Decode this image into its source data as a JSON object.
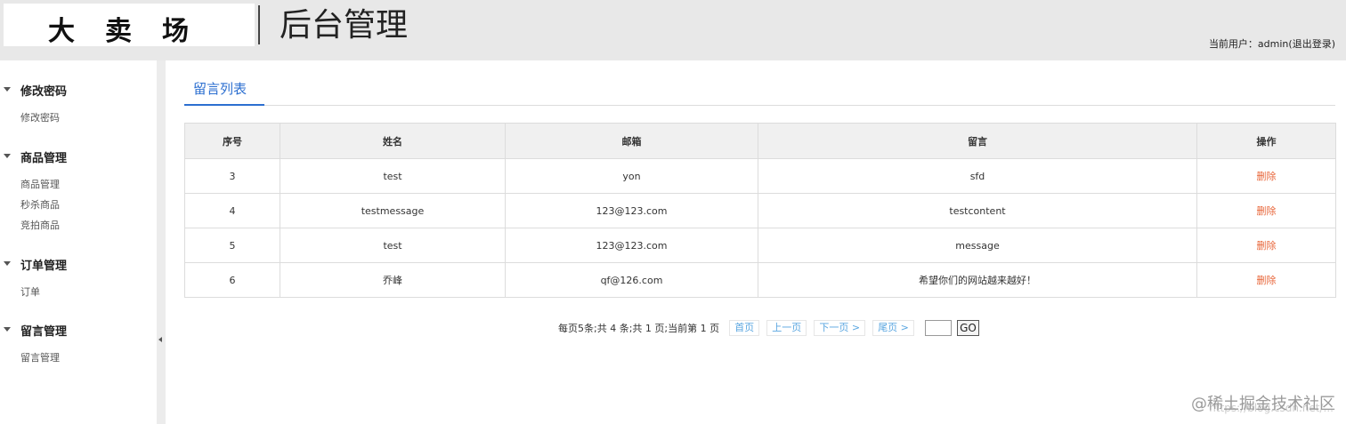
{
  "header": {
    "logo": "大卖场",
    "title": "后台管理",
    "user_prefix": "当前用户：admin",
    "logout": "(退出登录)"
  },
  "sidebar": {
    "groups": [
      {
        "title": "修改密码",
        "items": [
          "修改密码"
        ]
      },
      {
        "title": "商品管理",
        "items": [
          "商品管理",
          "秒杀商品",
          "竞拍商品"
        ]
      },
      {
        "title": "订单管理",
        "items": [
          "订单"
        ]
      },
      {
        "title": "留言管理",
        "items": [
          "留言管理"
        ]
      }
    ]
  },
  "main": {
    "tab": "留言列表",
    "table": {
      "headers": [
        "序号",
        "姓名",
        "邮箱",
        "留言",
        "操作"
      ],
      "rows": [
        {
          "id": "3",
          "name": "test",
          "email": "yon",
          "message": "sfd",
          "action": "删除"
        },
        {
          "id": "4",
          "name": "testmessage",
          "email": "123@123.com",
          "message": "testcontent",
          "action": "删除"
        },
        {
          "id": "5",
          "name": "test",
          "email": "123@123.com",
          "message": "message",
          "action": "删除"
        },
        {
          "id": "6",
          "name": "乔峰",
          "email": "qf@126.com",
          "message": "希望你们的网站越来越好！",
          "action": "删除"
        }
      ]
    },
    "pager": {
      "summary": "每页5条;共 4 条;共 1 页;当前第 1 页",
      "first": "首页",
      "prev": "上一页",
      "next": "下一页 >",
      "last": "尾页 >",
      "page_input": "",
      "go": "GO"
    }
  },
  "watermark": {
    "text": "@稀土掘金技术社区",
    "url": "https://blog.csdn.net/..."
  },
  "colors": {
    "header_bg": "#e8e8e8",
    "tab_accent": "#2c6fd0",
    "delete_link": "#e8663a",
    "pager_link": "#5aa6e0"
  }
}
